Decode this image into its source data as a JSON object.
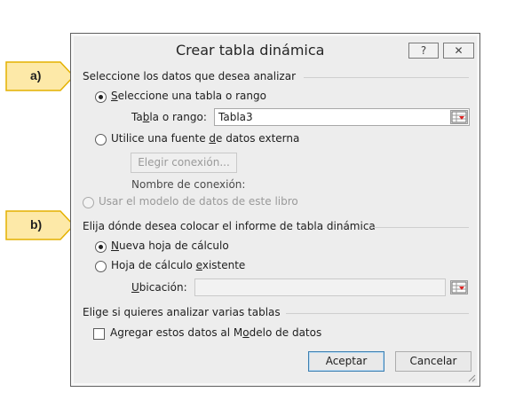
{
  "callouts": {
    "a_label": "a)",
    "b_label": "b)"
  },
  "dialog": {
    "title": "Crear tabla dinámica",
    "help_glyph": "?",
    "close_glyph": "✕",
    "section1": {
      "label": "Seleccione los datos que desea analizar",
      "radio_table_pre": "",
      "radio_table_u": "S",
      "radio_table_post": "eleccione una tabla o rango",
      "range_label_pre": "Ta",
      "range_label_u": "b",
      "range_label_post": "la o rango:",
      "range_value": "Tabla3",
      "radio_external_pre": "Utilice una fuente ",
      "radio_external_u": "d",
      "radio_external_post": "e datos externa",
      "choose_connection": "Elegir conexión...",
      "connection_name_label": "Nombre de conexión:",
      "radio_model": "Usar el modelo de datos de este libro"
    },
    "section2": {
      "label": "Elija dónde desea colocar el informe de tabla dinámica",
      "radio_new_pre": "",
      "radio_new_u": "N",
      "radio_new_post": "ueva hoja de cálculo",
      "radio_existing_pre": "Hoja de cálculo ",
      "radio_existing_u": "e",
      "radio_existing_post": "xistente",
      "location_label_pre": "",
      "location_label_u": "U",
      "location_label_post": "bicación:",
      "location_value": ""
    },
    "section3": {
      "label": "Elige si quieres analizar varias tablas",
      "checkbox_pre": "Agregar estos datos al M",
      "checkbox_u": "o",
      "checkbox_post": "delo de datos"
    },
    "buttons": {
      "ok": "Aceptar",
      "cancel": "Cancelar"
    }
  },
  "colors": {
    "callout_fill": "#fde9a8",
    "callout_border": "#e4b100",
    "dialog_bg": "#ededed"
  }
}
